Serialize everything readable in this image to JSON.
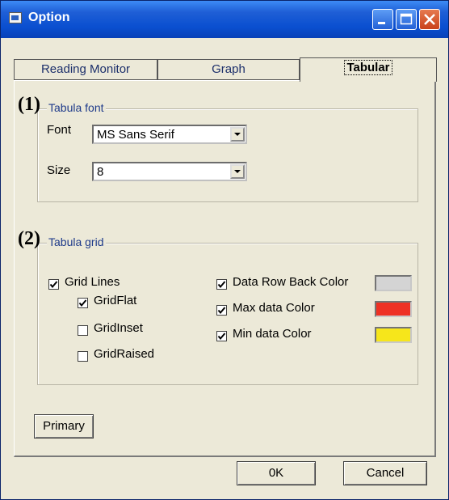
{
  "window": {
    "title": "Option"
  },
  "tabs": [
    {
      "label": "Reading Monitor",
      "active": false
    },
    {
      "label": "Graph",
      "active": false
    },
    {
      "label": "Tabular",
      "active": true
    }
  ],
  "font_group": {
    "marker": "(1)",
    "title": "Tabula font",
    "font_label": "Font",
    "font_value": "MS Sans Serif",
    "size_label": "Size",
    "size_value": "8"
  },
  "grid_group": {
    "marker": "(2)",
    "title": "Tabula grid",
    "left_checks": [
      {
        "label": "Grid Lines",
        "checked": true
      },
      {
        "label": "GridFlat",
        "checked": true
      },
      {
        "label": "GridInset",
        "checked": false
      },
      {
        "label": "GridRaised",
        "checked": false
      }
    ],
    "right_checks": [
      {
        "label": "Data Row Back Color",
        "checked": true,
        "color": "#d4d4d4"
      },
      {
        "label": "Max  data Color",
        "checked": true,
        "color": "#ee3124"
      },
      {
        "label": "Min data Color",
        "checked": true,
        "color": "#f6e61b"
      }
    ]
  },
  "buttons": {
    "primary": "Primary",
    "ok": "0K",
    "cancel": "Cancel"
  }
}
